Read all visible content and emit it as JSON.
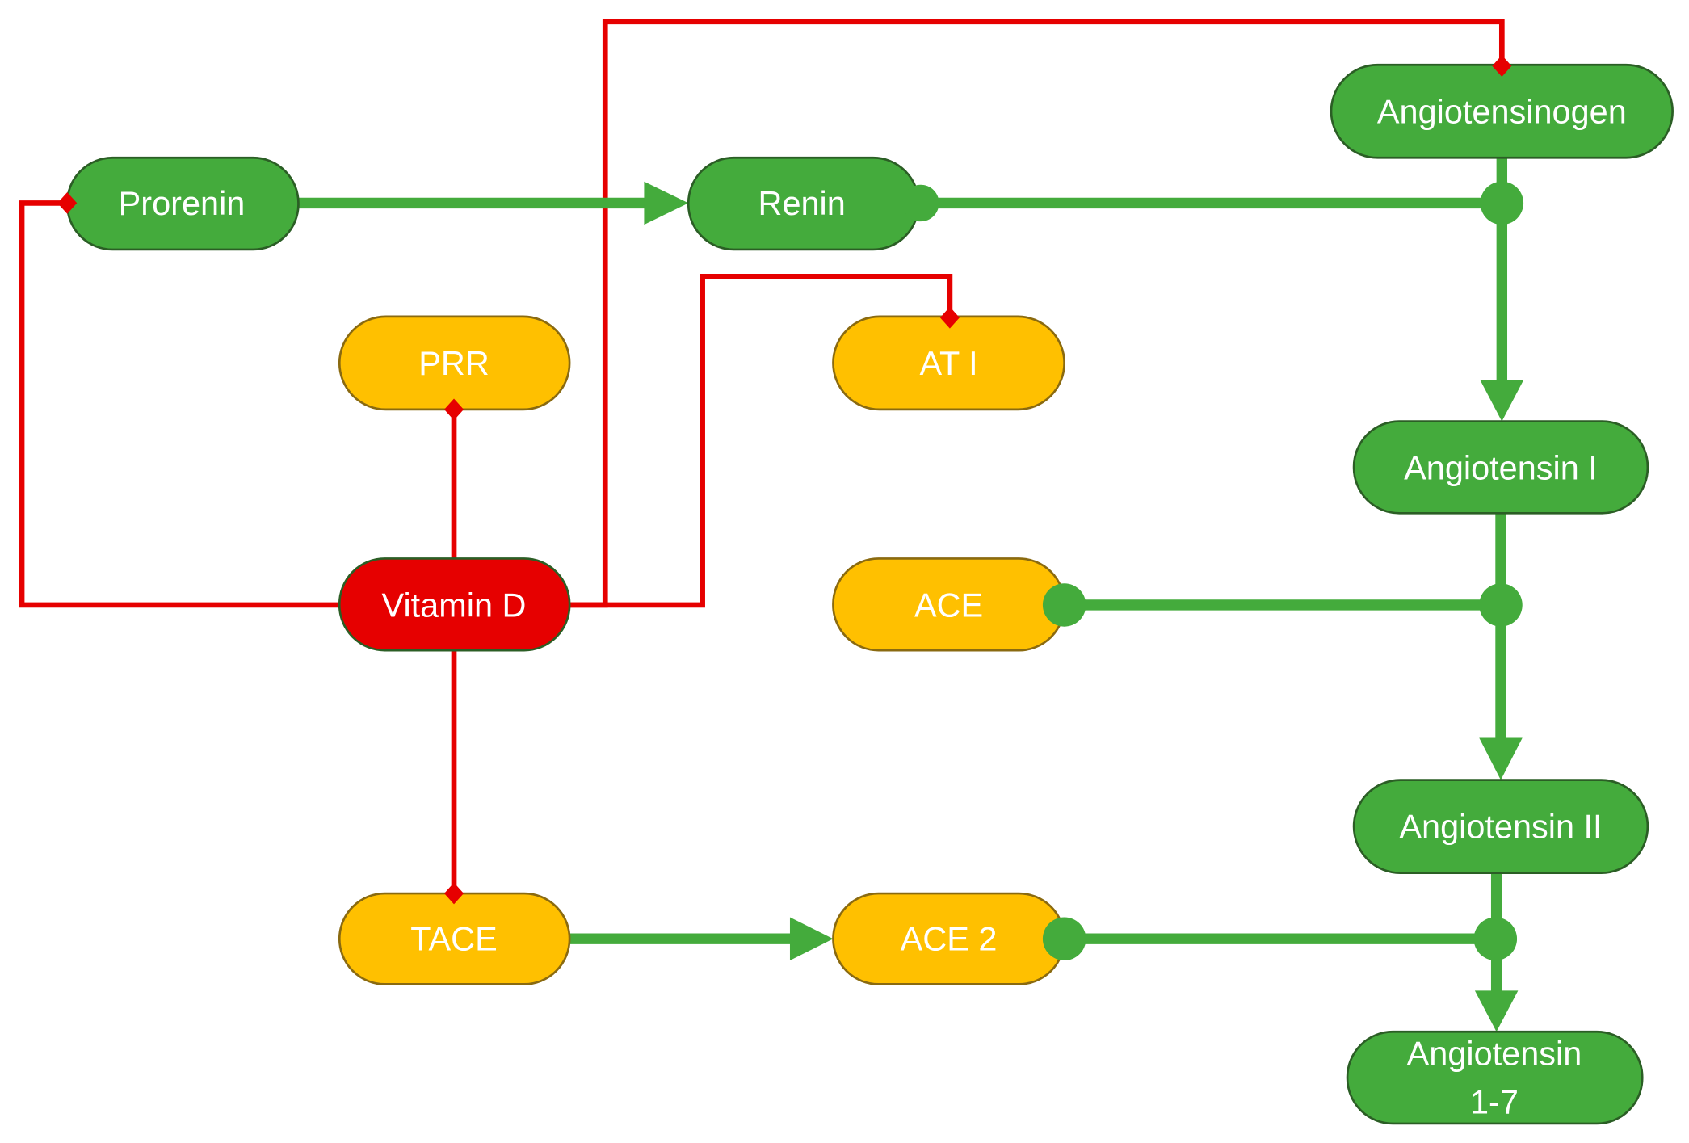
{
  "colors": {
    "enzyme_node": "#44ab3c",
    "receptor_node": "#ffc000",
    "vitamin_node": "#e60000",
    "inhibition_line": "#e60000",
    "activation_line": "#44ab3c"
  },
  "nodes": {
    "angiotensinogen": "Angiotensinogen",
    "prorenin": "Prorenin",
    "renin": "Renin",
    "prr": "PRR",
    "at1": "AT I",
    "angiotensin1": "Angiotensin I",
    "vitamin_d": "Vitamin D",
    "ace": "ACE",
    "angiotensin2": "Angiotensin II",
    "tace": "TACE",
    "ace2": "ACE 2",
    "angiotensin17_line1": "Angiotensin",
    "angiotensin17_line2": "1-7"
  }
}
